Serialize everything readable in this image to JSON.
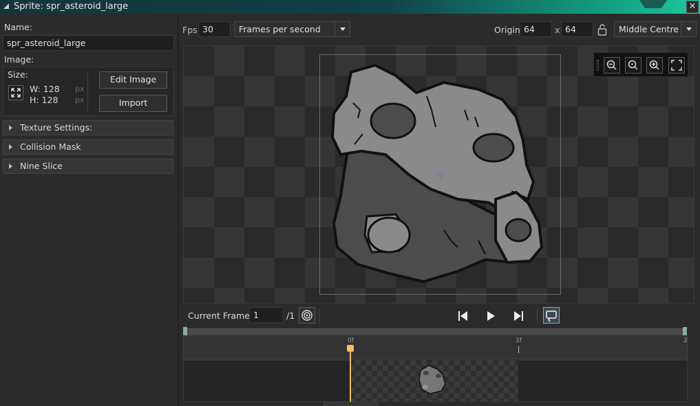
{
  "window": {
    "title": "Sprite: spr_asteroid_large",
    "close_glyph": "✕"
  },
  "left_panel": {
    "name_label": "Name:",
    "name_value": "spr_asteroid_large",
    "image_label": "Image:",
    "size_label": "Size:",
    "width_label": "W: 128",
    "height_label": "H: 128",
    "unit": "px",
    "edit_image_button": "Edit Image",
    "import_button": "Import",
    "sections": [
      {
        "label": "Texture Settings:"
      },
      {
        "label": "Collision Mask"
      },
      {
        "label": "Nine Slice"
      }
    ]
  },
  "toolbar": {
    "fps_label": "Fps",
    "fps_value": "30",
    "speed_mode": "Frames per second",
    "origin_label": "Origin",
    "origin_x": "64",
    "origin_sep": "x",
    "origin_y": "64",
    "origin_preset": "Middle Centre"
  },
  "frame_bar": {
    "current_frame_label": "Current Frame:",
    "current_frame_value": "1",
    "frame_total": "/1"
  },
  "timeline": {
    "ticks": [
      "0f",
      "1f",
      "2"
    ]
  },
  "icons": {
    "expand": "expand-arrows-icon",
    "lock": "unlock-icon",
    "zoom_out": "zoom-out-icon",
    "zoom_reset": "zoom-reset-icon",
    "zoom_in": "zoom-in-icon",
    "fit": "fit-screen-icon",
    "onion": "onion-skin-icon",
    "first": "skip-back-icon",
    "play": "play-icon",
    "last": "skip-forward-icon",
    "loop": "loop-icon"
  },
  "colors": {
    "title_gradient_end": "#21c8a0",
    "playhead": "#f0c060",
    "panel": "#2b2b2b"
  }
}
